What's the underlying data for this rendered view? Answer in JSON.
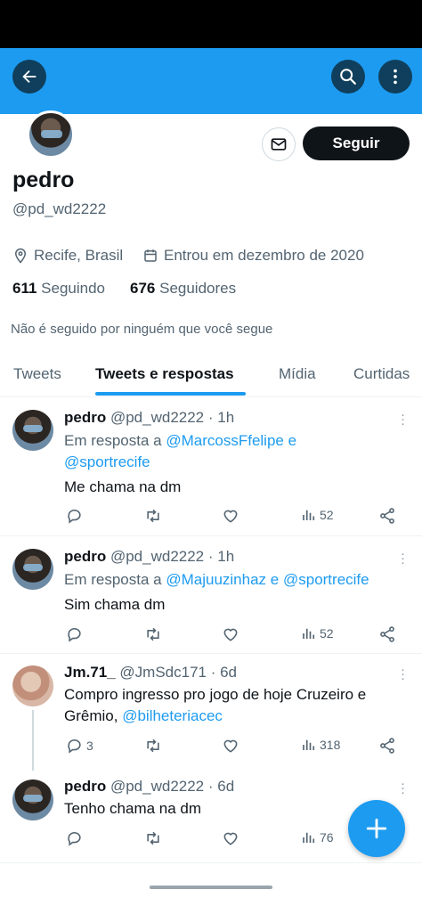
{
  "header": {
    "back_icon": "arrow-left-icon",
    "search_icon": "search-icon",
    "more_icon": "more-vertical-icon"
  },
  "profile": {
    "name": "pedro",
    "handle": "@pd_wd2222",
    "location": "Recife, Brasil",
    "joined": "Entrou em dezembro de 2020",
    "following_count": "611",
    "following_label": "Seguindo",
    "followers_count": "676",
    "followers_label": "Seguidores",
    "known_followers": "Não é seguido por ninguém que você segue",
    "follow_button": "Seguir",
    "message_icon": "envelope-icon"
  },
  "tabs": [
    {
      "label": "Tweets"
    },
    {
      "label": "Tweets e respostas"
    },
    {
      "label": "Mídia"
    },
    {
      "label": "Curtidas"
    }
  ],
  "active_tab": "Tweets e respostas",
  "tweets": [
    {
      "name": "pedro",
      "meta": "@pd_wd2222 · 1h",
      "reply_prefix": "Em resposta a",
      "reply_to_1": "@MarcossFfelipe",
      "reply_conj": "e",
      "reply_to_2": "@sportrecife",
      "text": "Me chama na dm",
      "views": "52"
    },
    {
      "name": "pedro",
      "meta": "@pd_wd2222 · 1h",
      "reply_prefix": "Em resposta a",
      "reply_to_1": "@Majuuzinhaz",
      "reply_conj": "e",
      "reply_to_2": "@sportrecife",
      "text": "Sim chama dm",
      "views": "52"
    },
    {
      "name": "Jm.71_",
      "meta": "@JmSdc171 · 6d",
      "text_1": "Compro ingresso pro jogo de hoje Cruzeiro e",
      "text_2": "Grêmio,",
      "mention": "@bilheteriacec",
      "replies": "3",
      "views": "318"
    },
    {
      "name": "pedro",
      "meta": "@pd_wd2222 · 6d",
      "text": "Tenho chama na dm",
      "views": "76"
    }
  ],
  "fab_icon": "plus-icon",
  "colors": {
    "accent": "#1d9bf0",
    "text": "#0f1419",
    "secondary": "#536471"
  }
}
